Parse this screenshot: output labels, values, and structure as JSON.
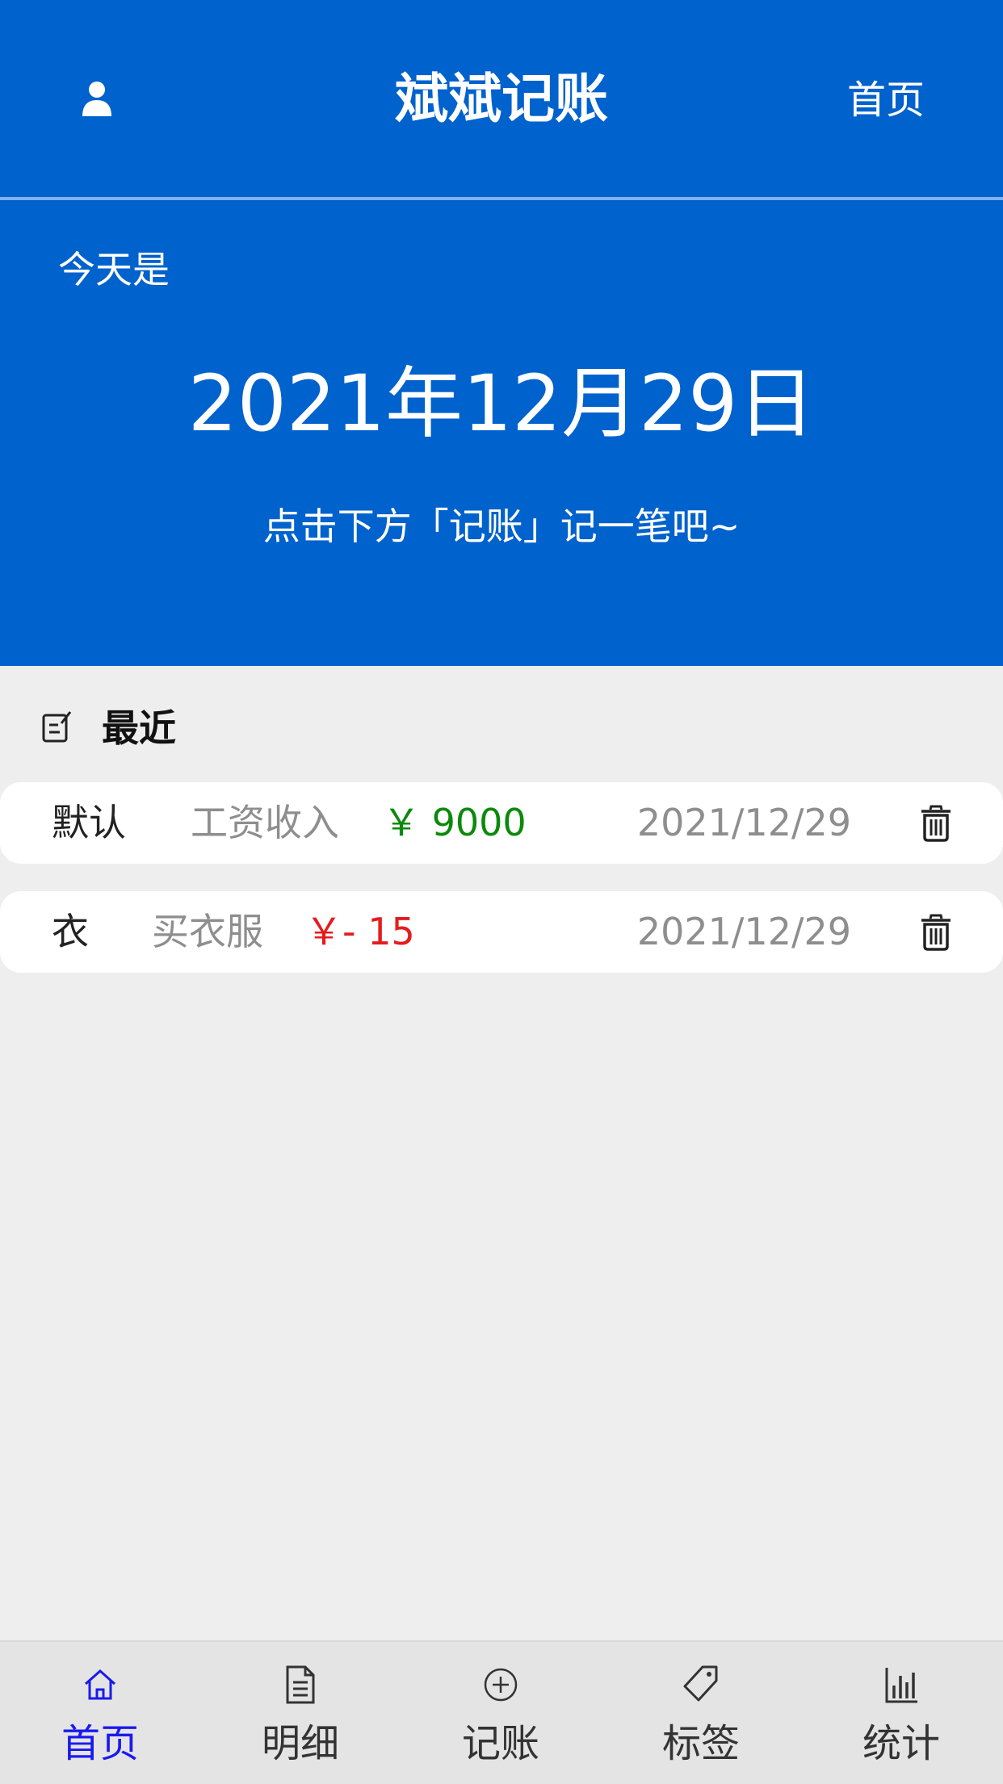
{
  "header": {
    "title": "斌斌记账",
    "home_link": "首页",
    "user_icon": "user-icon"
  },
  "hero": {
    "today_label": "今天是",
    "date": "2021年12月29日",
    "hint": "点击下方「记账」记一笔吧~"
  },
  "recent": {
    "label": "最近",
    "icon": "edit-icon",
    "records": [
      {
        "category": "默认",
        "note": "工资收入",
        "amount": "￥ 9000",
        "type": "income",
        "date": "2021/12/29"
      },
      {
        "category": "衣",
        "note": "买衣服",
        "amount": "￥- 15",
        "type": "expense",
        "date": "2021/12/29"
      }
    ]
  },
  "tabbar": {
    "items": [
      {
        "label": "首页",
        "icon": "home-icon",
        "active": true
      },
      {
        "label": "明细",
        "icon": "document-icon",
        "active": false
      },
      {
        "label": "记账",
        "icon": "add-circle-icon",
        "active": false
      },
      {
        "label": "标签",
        "icon": "tag-icon",
        "active": false
      },
      {
        "label": "统计",
        "icon": "chart-icon",
        "active": false
      }
    ]
  },
  "colors": {
    "primary": "#0062cc",
    "income": "#0a8a0a",
    "expense": "#e51c1c",
    "active_tab": "#1a1aee"
  }
}
